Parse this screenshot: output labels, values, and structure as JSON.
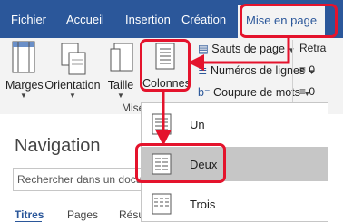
{
  "tabs": [
    "Fichier",
    "Accueil",
    "Insertion",
    "Création",
    "Mise en page"
  ],
  "ribbon": {
    "margins": "Marges",
    "orientation": "Orientation",
    "size": "Taille",
    "columns": "Colonnes",
    "breaks": "Sauts de page",
    "line_numbers": "Numéros de lignes",
    "hyphenation": "Coupure de mots",
    "group_label": "Mise",
    "right_top": "Retra",
    "right_mid": "≡ 0",
    "right_bot": "≡ 0"
  },
  "columns_menu": {
    "items": [
      "Un",
      "Deux",
      "Trois"
    ],
    "selected": "Deux"
  },
  "navigation": {
    "title": "Navigation",
    "search_placeholder": "Rechercher dans un docu",
    "tabs": [
      "Titres",
      "Pages",
      "Résu"
    ]
  },
  "colors": {
    "accent": "#2b579a",
    "highlight": "#e4132c",
    "selected_bg": "#c6c6c6"
  }
}
